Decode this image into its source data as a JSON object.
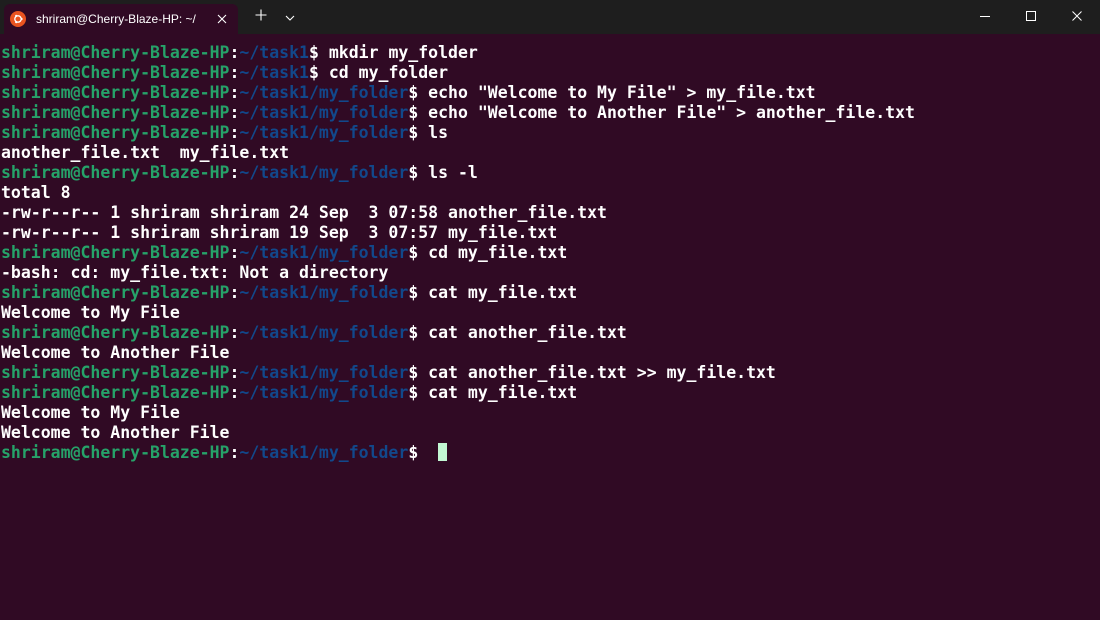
{
  "window": {
    "tab_title": "shriram@Cherry-Blaze-HP: ~/",
    "icons": {
      "tab_icon": "ubuntu-logo-icon",
      "tab_close": "close-icon",
      "new_tab": "plus-icon",
      "dropdown": "chevron-down-icon",
      "minimize": "minimize-icon",
      "maximize": "maximize-icon",
      "close": "close-icon"
    }
  },
  "colors": {
    "background": "#300a24",
    "titlebar": "#1e1e1e",
    "user_host": "#26a269",
    "path": "#12488b",
    "text": "#ffffff",
    "cursor": "#c3f7d3",
    "ubuntu_orange": "#e95420"
  },
  "terminal": {
    "lines": [
      {
        "user": "shriram@Cherry-Blaze-HP",
        "path": "~/task1",
        "cmd": "$ mkdir my_folder"
      },
      {
        "user": "shriram@Cherry-Blaze-HP",
        "path": "~/task1",
        "cmd": "$ cd my_folder"
      },
      {
        "user": "shriram@Cherry-Blaze-HP",
        "path": "~/task1/my_folder",
        "cmd": "$ echo \"Welcome to My File\" > my_file.txt"
      },
      {
        "user": "shriram@Cherry-Blaze-HP",
        "path": "~/task1/my_folder",
        "cmd": "$ echo \"Welcome to Another File\" > another_file.txt"
      },
      {
        "user": "shriram@Cherry-Blaze-HP",
        "path": "~/task1/my_folder",
        "cmd": "$ ls"
      },
      {
        "text": "another_file.txt  my_file.txt"
      },
      {
        "user": "shriram@Cherry-Blaze-HP",
        "path": "~/task1/my_folder",
        "cmd": "$ ls -l"
      },
      {
        "text": "total 8"
      },
      {
        "text": "-rw-r--r-- 1 shriram shriram 24 Sep  3 07:58 another_file.txt"
      },
      {
        "text": "-rw-r--r-- 1 shriram shriram 19 Sep  3 07:57 my_file.txt"
      },
      {
        "user": "shriram@Cherry-Blaze-HP",
        "path": "~/task1/my_folder",
        "cmd": "$ cd my_file.txt"
      },
      {
        "text": "-bash: cd: my_file.txt: Not a directory"
      },
      {
        "user": "shriram@Cherry-Blaze-HP",
        "path": "~/task1/my_folder",
        "cmd": "$ cat my_file.txt"
      },
      {
        "text": "Welcome to My File"
      },
      {
        "user": "shriram@Cherry-Blaze-HP",
        "path": "~/task1/my_folder",
        "cmd": "$ cat another_file.txt"
      },
      {
        "text": "Welcome to Another File"
      },
      {
        "user": "shriram@Cherry-Blaze-HP",
        "path": "~/task1/my_folder",
        "cmd": "$ cat another_file.txt >> my_file.txt"
      },
      {
        "user": "shriram@Cherry-Blaze-HP",
        "path": "~/task1/my_folder",
        "cmd": "$ cat my_file.txt"
      },
      {
        "text": "Welcome to My File"
      },
      {
        "text": "Welcome to Another File"
      },
      {
        "user": "shriram@Cherry-Blaze-HP",
        "path": "~/task1/my_folder",
        "cmd": "$ ",
        "cursor": true
      }
    ]
  }
}
